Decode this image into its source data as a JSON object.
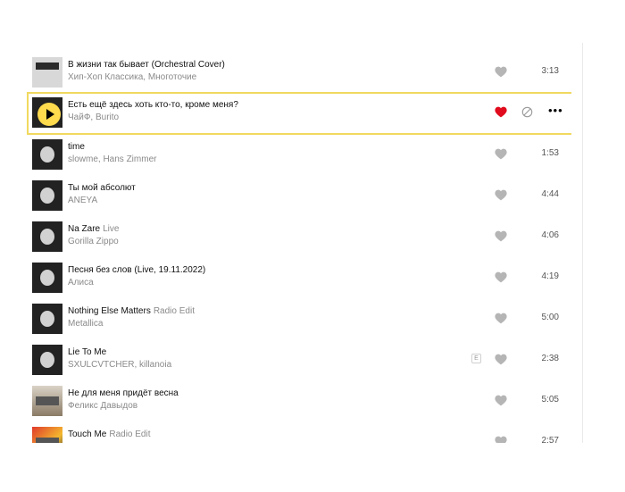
{
  "tracks": [
    {
      "title": "В жизни так бывает (Orchestral Cover)",
      "version": "",
      "artist": "Хип-Хоп Классика, Многоточие",
      "duration": "3:13",
      "liked": false,
      "explicit": false,
      "active": false,
      "cover": "c-light"
    },
    {
      "title": "Есть ещё здесь хоть кто-то, кроме меня?",
      "version": "",
      "artist": "ЧайФ, Burito",
      "duration": "",
      "liked": true,
      "explicit": false,
      "active": true,
      "cover": "c-dark"
    },
    {
      "title": "time",
      "version": "",
      "artist": "slowme, Hans Zimmer",
      "duration": "1:53",
      "liked": false,
      "explicit": false,
      "active": false,
      "cover": "c-dark"
    },
    {
      "title": "Ты мой абсолют",
      "version": "",
      "artist": "ANEYA",
      "duration": "4:44",
      "liked": false,
      "explicit": false,
      "active": false,
      "cover": "c-dark"
    },
    {
      "title": "Na Zare",
      "version": "Live",
      "artist": "Gorilla Zippo",
      "duration": "4:06",
      "liked": false,
      "explicit": false,
      "active": false,
      "cover": "c-dark"
    },
    {
      "title": "Песня без слов (Live, 19.11.2022)",
      "version": "",
      "artist": "Алиса",
      "duration": "4:19",
      "liked": false,
      "explicit": false,
      "active": false,
      "cover": "c-dark"
    },
    {
      "title": "Nothing Else Matters",
      "version": "Radio Edit",
      "artist": "Metallica",
      "duration": "5:00",
      "liked": false,
      "explicit": false,
      "active": false,
      "cover": "c-dark"
    },
    {
      "title": "Lie To Me",
      "version": "",
      "artist": "SXULCVTCHER, killanoia",
      "duration": "2:38",
      "liked": false,
      "explicit": true,
      "active": false,
      "cover": "c-dark"
    },
    {
      "title": "Не для меня придёт весна",
      "version": "",
      "artist": "Феликс Давыдов",
      "duration": "5:05",
      "liked": false,
      "explicit": false,
      "active": false,
      "cover": "c-sepia"
    },
    {
      "title": "Touch Me",
      "version": "Radio Edit",
      "artist": "",
      "duration": "2:57",
      "liked": false,
      "explicit": false,
      "active": false,
      "cover": "c-color"
    }
  ],
  "explicit_label": "E",
  "more_label": "•••",
  "colors": {
    "liked": "#e00b1c",
    "heart_idle": "#b5b5b5",
    "active_border": "#f1d960",
    "play": "#ffdb4d"
  },
  "icons": {
    "heart": "heart-icon",
    "block": "block-icon",
    "play": "play-icon",
    "more": "more-icon"
  }
}
